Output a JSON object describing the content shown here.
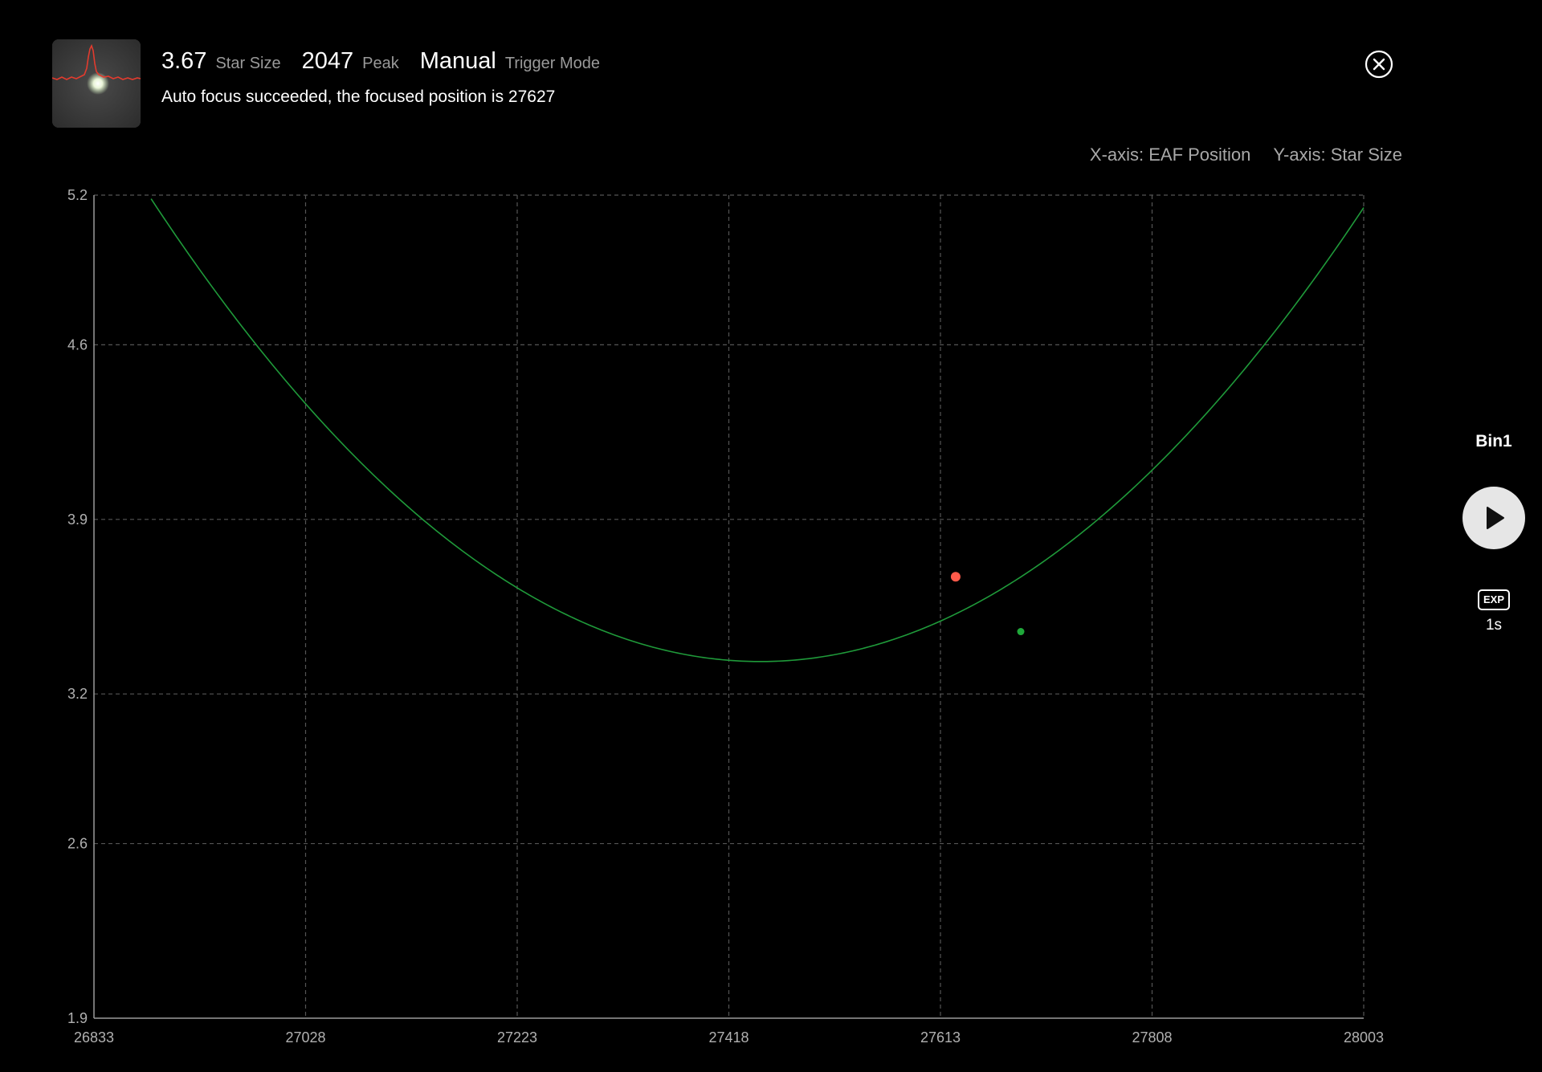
{
  "header": {
    "star_size_value": "3.67",
    "star_size_label": "Star Size",
    "peak_value": "2047",
    "peak_label": "Peak",
    "trigger_value": "Manual",
    "trigger_label": "Trigger Mode",
    "status_message": "Auto focus succeeded, the focused position is 27627"
  },
  "axis_legend": {
    "x_label": "X-axis: EAF Position",
    "y_label": "Y-axis: Star Size"
  },
  "side_panel": {
    "bin_label": "Bin1",
    "exp_badge": "EXP",
    "exp_value": "1s"
  },
  "icons": {
    "close": "close-circle-icon",
    "play": "play-icon",
    "thumbnail": "star-profile-thumbnail"
  },
  "colors": {
    "background": "#000000",
    "curve": "#1f9a3a",
    "measured_point": "#ff5a4a",
    "focus_point": "#1fa83a",
    "grid": "#555555"
  },
  "chart_data": {
    "type": "scatter",
    "xlim": [
      26833,
      28003
    ],
    "ylim": [
      1.9,
      5.2
    ],
    "x_ticks": [
      26833,
      27028,
      27223,
      27418,
      27613,
      27808,
      28003
    ],
    "y_ticks": [
      "5.2",
      "4.6",
      "3.9",
      "3.2",
      "2.6",
      "1.9"
    ],
    "y_tick_values": [
      5.2,
      4.6,
      3.9,
      3.2,
      2.6,
      1.9
    ],
    "grid": true,
    "fit_curve": {
      "kind": "parabola",
      "vertex_x": 27447,
      "vertex_y": 3.33,
      "through_x": 28003,
      "through_y": 5.15
    },
    "points": [
      {
        "x": 27627,
        "y": 3.67,
        "color": "#ff5a4a"
      },
      {
        "x": 27687,
        "y": 3.45,
        "color": "#1fa83a"
      }
    ]
  }
}
